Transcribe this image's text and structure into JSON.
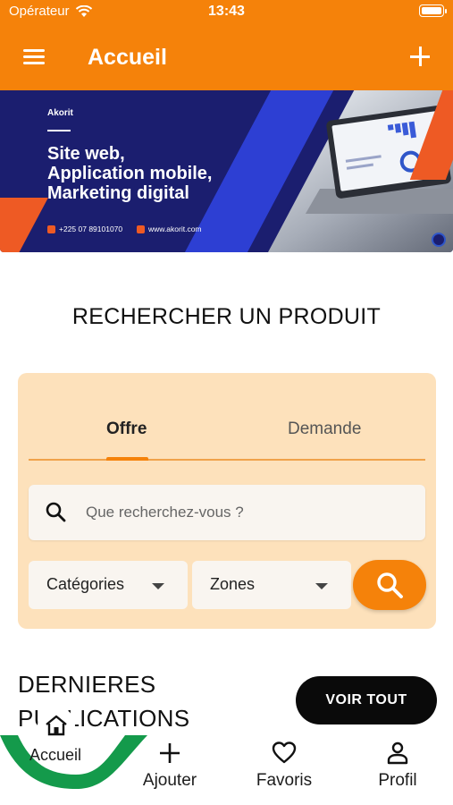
{
  "status_bar": {
    "carrier": "Opérateur",
    "time": "13:43",
    "wifi_icon": "wifi-icon",
    "battery_icon": "battery-icon"
  },
  "app_bar": {
    "title": "Accueil",
    "menu_icon": "hamburger-menu-icon",
    "add_icon": "plus-icon",
    "color": "#f5820a"
  },
  "banner": {
    "brand": "Akorit",
    "headline_1": "Site web,",
    "headline_2": "Application mobile,",
    "headline_3": "Marketing digital",
    "phone": "+225 07 89101070",
    "website": "www.akorit.com"
  },
  "search_section": {
    "title": "RECHERCHER UN PRODUIT",
    "tabs": [
      {
        "label": "Offre",
        "selected": true
      },
      {
        "label": "Demande",
        "selected": false
      }
    ],
    "search_placeholder": "Que recherchez-vous ?",
    "categories_label": "Catégories",
    "zones_label": "Zones",
    "search_button_icon": "search-icon"
  },
  "latest": {
    "title": "DERNIERES PUBLICATIONS",
    "see_all_label": "VOIR TOUT"
  },
  "bottom_nav": {
    "items": [
      {
        "label": "Accueil",
        "icon": "home-icon",
        "active": true
      },
      {
        "label": "Ajouter",
        "icon": "plus-icon"
      },
      {
        "label": "Favoris",
        "icon": "heart-icon"
      },
      {
        "label": "Profil",
        "icon": "person-icon"
      }
    ],
    "accent": "#149a4b"
  }
}
